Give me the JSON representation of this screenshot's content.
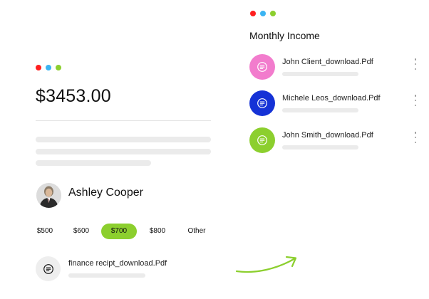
{
  "colors": {
    "dot_red": "#ff1f1f",
    "dot_blue": "#3bb4f2",
    "dot_green": "#8ccf2e",
    "accent_green": "#8ccf2e",
    "pink": "#f27ccd",
    "blue": "#1532d6",
    "green": "#8ccf2e"
  },
  "left_card": {
    "amount": "$3453.00",
    "user": {
      "name": "Ashley Cooper",
      "avatar_icon": "person-photo-icon"
    },
    "amount_options": [
      {
        "label": "$500",
        "selected": false
      },
      {
        "label": "$600",
        "selected": false
      },
      {
        "label": "$700",
        "selected": true
      },
      {
        "label": "$800",
        "selected": false
      },
      {
        "label": "Other",
        "selected": false
      }
    ],
    "file": {
      "name": "finance recipt_download.Pdf",
      "icon": "document-icon"
    }
  },
  "right_panel": {
    "title": "Monthly Income",
    "files": [
      {
        "name": "John Client_download.Pdf",
        "icon": "document-icon",
        "icon_color": "#f27ccd"
      },
      {
        "name": "Michele Leos_download.Pdf",
        "icon": "document-icon",
        "icon_color": "#1532d6"
      },
      {
        "name": "John Smith_download.Pdf",
        "icon": "document-icon",
        "icon_color": "#8ccf2e"
      }
    ]
  }
}
